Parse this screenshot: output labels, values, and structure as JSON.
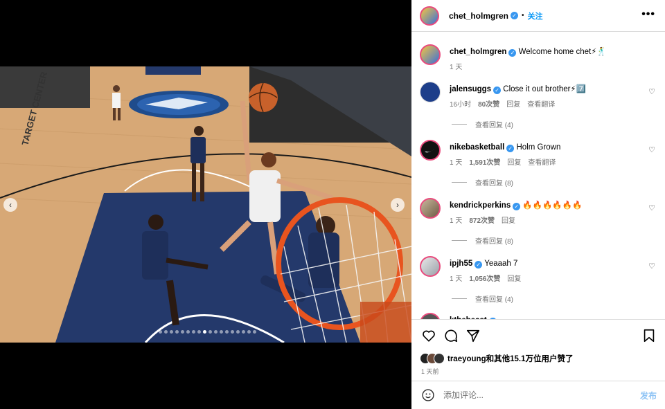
{
  "post": {
    "author": "chet_holmgren",
    "follow_label": "关注",
    "separator": "•",
    "more_label": "•••"
  },
  "caption": {
    "user": "chet_holmgren",
    "text": "Welcome home chet⚡🕺",
    "time": "1 天"
  },
  "comments": [
    {
      "user": "jalensuggs",
      "text": "Close it out brother⚡7️⃣",
      "time": "16小时",
      "likes": "80次赞",
      "reply": "回复",
      "translate": "查看翻译",
      "view_replies": "查看回复 (4)"
    },
    {
      "user": "nikebasketball",
      "text": "Holm Grown",
      "time": "1 天",
      "likes": "1,591次赞",
      "reply": "回复",
      "translate": "查看翻译",
      "view_replies": "查看回复 (8)"
    },
    {
      "user": "kendrickperkins",
      "text": "🔥🔥🔥🔥🔥🔥",
      "time": "1 天",
      "likes": "872次赞",
      "reply": "回复",
      "view_replies": "查看回复 (8)"
    },
    {
      "user": "ipjh55",
      "text": "Yeaaah 7",
      "time": "1 天",
      "likes": "1,056次赞",
      "reply": "回复",
      "view_replies": "查看回复 (4)"
    },
    {
      "user": "kthebeast"
    }
  ],
  "likes_summary": {
    "user": "traeyoung",
    "text": "和其他15.1万位用户赞了"
  },
  "post_time": "1 天前",
  "composer": {
    "placeholder": "添加评论...",
    "post_label": "发布"
  },
  "colors": {
    "accent": "#0095f6",
    "verified": "#3897f0",
    "court_blue": "#24396b",
    "rim_orange": "#e8541f"
  }
}
